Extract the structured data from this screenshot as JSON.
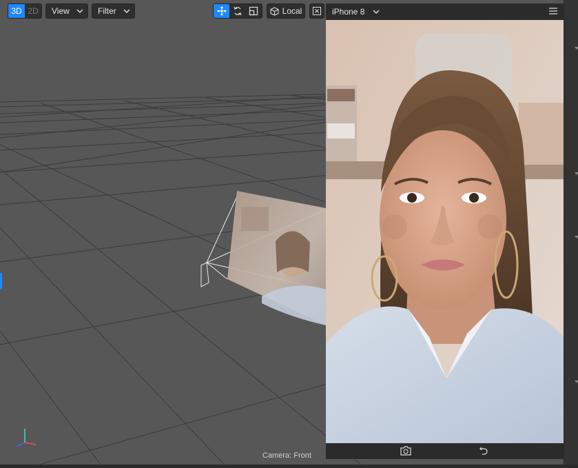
{
  "toolbar": {
    "dim_3d": "3D",
    "dim_2d": "2D",
    "view_label": "View",
    "filter_label": "Filter",
    "local_label": "Local",
    "active_tool": "move-tool"
  },
  "preview": {
    "device": "iPhone 8"
  },
  "viewport": {
    "camera_label": "Camera: Front"
  },
  "colors": {
    "accent": "#1e88ff",
    "viewport_bg": "#565656",
    "panel_bg": "#2b2b2b"
  }
}
